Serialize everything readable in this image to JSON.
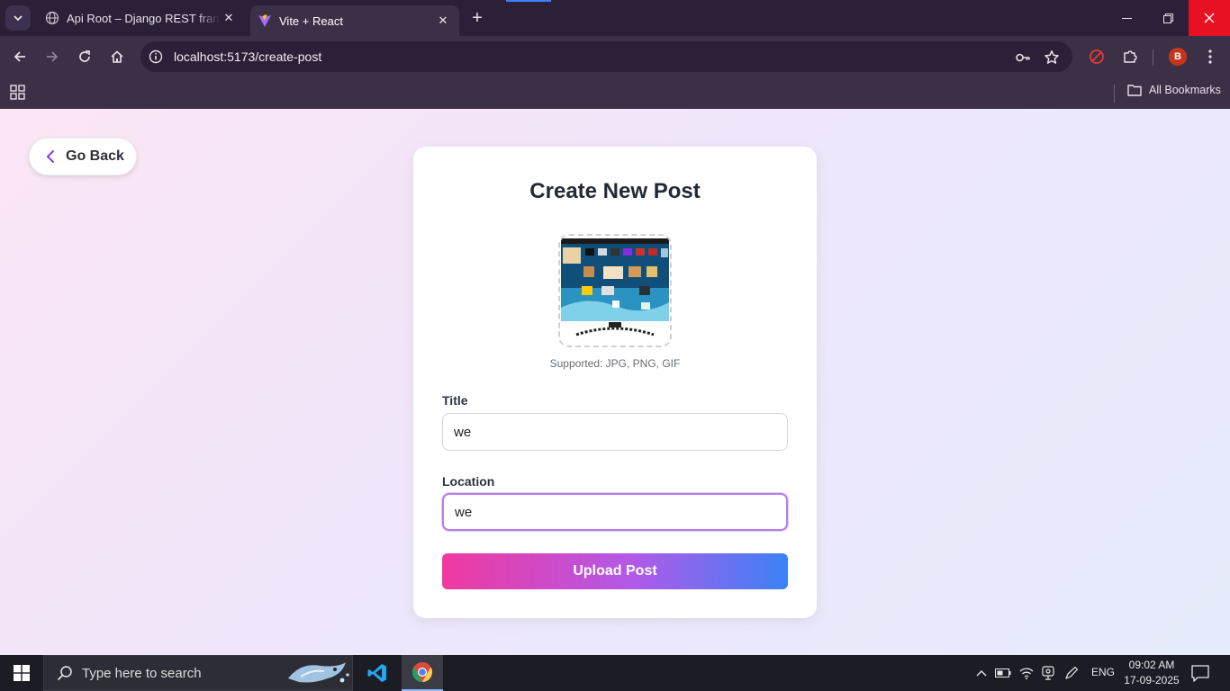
{
  "browser": {
    "tabs": [
      {
        "title": "Api Root – Django REST framew",
        "active": false
      },
      {
        "title": "Vite + React",
        "active": true
      }
    ],
    "url": "localhost:5173/create-post",
    "bookmarks_label": "All Bookmarks",
    "profile_initial": "B"
  },
  "page": {
    "go_back_label": "Go Back",
    "title": "Create New Post",
    "supported_text": "Supported: JPG, PNG, GIF",
    "fields": {
      "title": {
        "label": "Title",
        "value": "we"
      },
      "location": {
        "label": "Location",
        "value": "we"
      }
    },
    "submit_label": "Upload Post"
  },
  "taskbar": {
    "search_placeholder": "Type here to search",
    "language": "ENG",
    "time": "09:02 AM",
    "date": "17-09-2025"
  },
  "colors": {
    "button_gradient": [
      "#f0399f",
      "#b259e8",
      "#3b82f6"
    ],
    "focus_border": "#b77ee8",
    "close_button": "#e81123"
  }
}
